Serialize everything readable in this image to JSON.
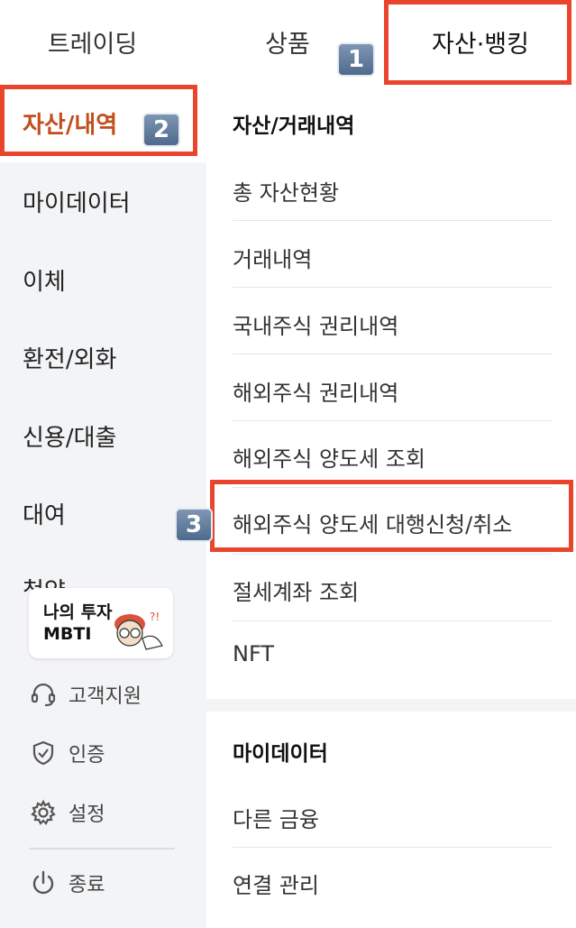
{
  "tabs": [
    {
      "label": "트레이딩"
    },
    {
      "label": "상품"
    },
    {
      "label": "자산·뱅킹"
    }
  ],
  "badges": [
    "1",
    "2",
    "3"
  ],
  "sidebar": {
    "items": [
      {
        "label": "자산/내역"
      },
      {
        "label": "마이데이터"
      },
      {
        "label": "이체"
      },
      {
        "label": "환전/외화"
      },
      {
        "label": "신용/대출"
      },
      {
        "label": "대여"
      },
      {
        "label": "청약"
      }
    ],
    "mbti_banner": {
      "line1": "나의 투자",
      "line2": "MBTI"
    },
    "utilities": [
      {
        "label": "고객지원",
        "icon": "headset-icon"
      },
      {
        "label": "인증",
        "icon": "shield-check-icon"
      },
      {
        "label": "설정",
        "icon": "gear-icon"
      },
      {
        "label": "종료",
        "icon": "power-icon"
      }
    ]
  },
  "main": {
    "sections": [
      {
        "title": "자산/거래내역",
        "items": [
          "총 자산현황",
          "거래내역",
          "국내주식 권리내역",
          "해외주식 권리내역",
          "해외주식 양도세 조회",
          "해외주식 양도세 대행신청/취소",
          "절세계좌 조회",
          "NFT"
        ]
      },
      {
        "title": "마이데이터",
        "items": [
          "다른 금융",
          "연결 관리"
        ]
      }
    ]
  },
  "colors": {
    "highlight": "#e8452c",
    "active_text": "#c24e1d",
    "sidebar_bg": "#f3f4f6"
  }
}
